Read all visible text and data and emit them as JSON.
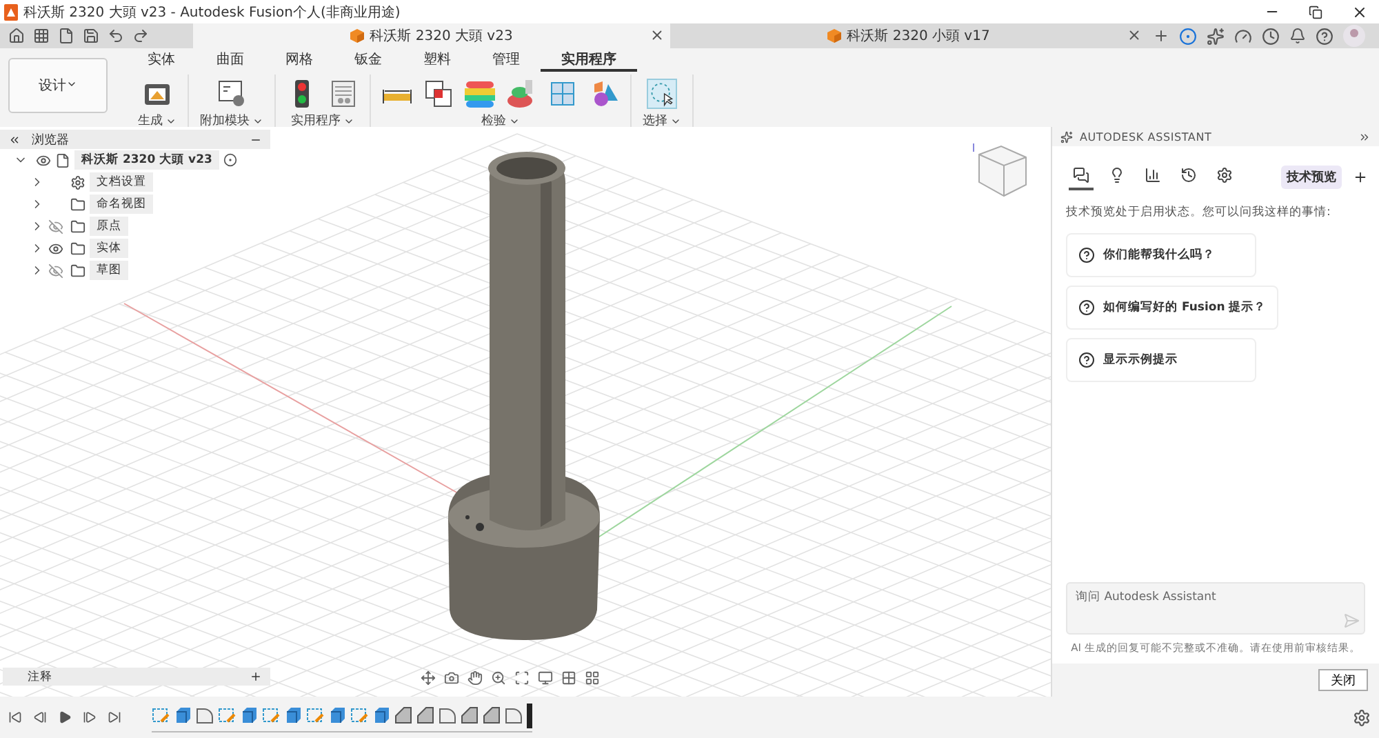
{
  "window": {
    "title": "科沃斯 2320 大頭 v23 - Autodesk Fusion个人(非商业用途)"
  },
  "doc_tabs": [
    {
      "title": "科沃斯 2320 大頭 v23",
      "selected": true
    },
    {
      "title": "科沃斯 2320 小頭 v17",
      "selected": false
    }
  ],
  "workspace": {
    "label": "设计"
  },
  "ribbon_tabs": [
    {
      "label": "实体",
      "selected": false
    },
    {
      "label": "曲面",
      "selected": false
    },
    {
      "label": "网格",
      "selected": false
    },
    {
      "label": "钣金",
      "selected": false
    },
    {
      "label": "塑料",
      "selected": false
    },
    {
      "label": "管理",
      "selected": false
    },
    {
      "label": "实用程序",
      "selected": true
    }
  ],
  "ribbon_groups": [
    {
      "label": "生成",
      "tools": [
        {
          "kind": "make"
        }
      ]
    },
    {
      "label": "附加模块",
      "tools": [
        {
          "kind": "script"
        }
      ]
    },
    {
      "label": "实用程序",
      "tools": [
        {
          "kind": "light"
        },
        {
          "kind": "table"
        }
      ]
    },
    {
      "label": "检验",
      "tools": [
        {
          "kind": "measure"
        },
        {
          "kind": "interference"
        },
        {
          "kind": "zebra"
        },
        {
          "kind": "draft"
        },
        {
          "kind": "section"
        },
        {
          "kind": "components"
        }
      ]
    },
    {
      "label": "选择",
      "tools": [
        {
          "kind": "select"
        }
      ]
    }
  ],
  "browser": {
    "title": "浏览器",
    "root": {
      "label": "科沃斯 2320 大頭 v23",
      "expanded": true,
      "visible": true,
      "children": [
        {
          "label": "文档设置",
          "kind": "settings"
        },
        {
          "label": "命名视图",
          "kind": "views"
        },
        {
          "label": "原点",
          "kind": "folder",
          "visible": false
        },
        {
          "label": "实体",
          "kind": "folder",
          "visible": true
        },
        {
          "label": "草图",
          "kind": "folder",
          "visible": false
        }
      ]
    }
  },
  "comments": {
    "title": "注释"
  },
  "assistant": {
    "title": "AUTODESK ASSISTANT",
    "tabs": [
      {
        "kind": "chat",
        "selected": true
      },
      {
        "kind": "ideas",
        "selected": false
      },
      {
        "kind": "library",
        "selected": false
      },
      {
        "kind": "history",
        "selected": false
      },
      {
        "kind": "settings",
        "selected": false
      }
    ],
    "badge": "技术预览",
    "intro": "技术预览处于启用状态。您可以问我这样的事情:",
    "suggestions": [
      "你们能帮我什么吗？",
      "如何编写好的 Fusion 提示？",
      "显示示例提示"
    ],
    "input": {
      "placeholder": "询问 Autodesk Assistant"
    },
    "disclaimer": "AI 生成的回复可能不完整或不准确。请在使用前审核结果。",
    "close_button": "关闭"
  },
  "timeline": {
    "features": [
      {
        "kind": "sketch"
      },
      {
        "kind": "extrude"
      },
      {
        "kind": "fillet"
      },
      {
        "kind": "sketch"
      },
      {
        "kind": "extrude"
      },
      {
        "kind": "sketch"
      },
      {
        "kind": "extrude"
      },
      {
        "kind": "sketch"
      },
      {
        "kind": "extrude"
      },
      {
        "kind": "sketch"
      },
      {
        "kind": "extrude"
      },
      {
        "kind": "chamfer"
      },
      {
        "kind": "chamfer"
      },
      {
        "kind": "fillet"
      },
      {
        "kind": "chamfer"
      },
      {
        "kind": "chamfer"
      },
      {
        "kind": "fillet"
      }
    ]
  }
}
